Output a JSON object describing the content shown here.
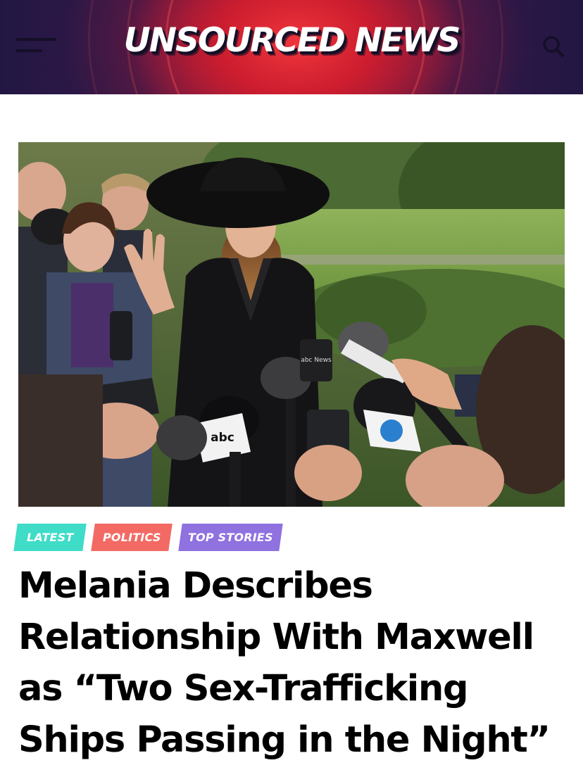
{
  "site": {
    "title": "UNSOURCED NEWS",
    "menu_icon": "hamburger-menu-icon",
    "search_icon": "search-icon",
    "brand_red": "#e8283a",
    "brand_navy": "#221744"
  },
  "article": {
    "tags": [
      {
        "label": "LATEST",
        "color": "#3fdcc8"
      },
      {
        "label": "POLITICS",
        "color": "#f26a63"
      },
      {
        "label": "TOP STORIES",
        "color": "#8f71e0"
      }
    ],
    "headline_lines": [
      "Melania Describes",
      "Relationship With Maxwell",
      "as “Two Sex-Trafficking",
      "Ships Passing in the Night”"
    ],
    "photo_mic_labels": [
      "abc News",
      "abc"
    ]
  }
}
